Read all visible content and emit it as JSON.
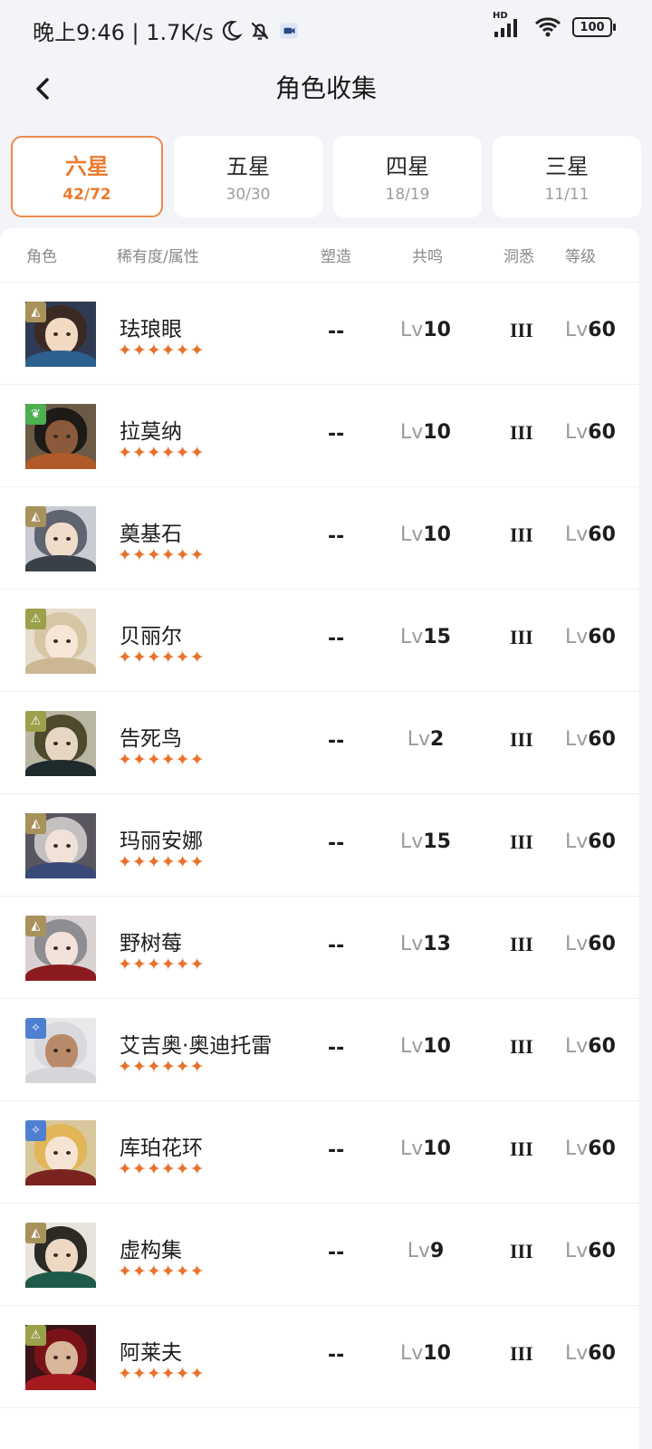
{
  "status_bar": {
    "time": "晚上9:46 | 1.7K/s",
    "network": "HD",
    "battery": "100"
  },
  "header": {
    "title": "角色收集"
  },
  "tabs": [
    {
      "label": "六星",
      "count": "42/72",
      "active": true
    },
    {
      "label": "五星",
      "count": "30/30",
      "active": false
    },
    {
      "label": "四星",
      "count": "18/19",
      "active": false
    },
    {
      "label": "三星",
      "count": "11/11",
      "active": false
    }
  ],
  "columns": {
    "character": "角色",
    "rarity": "稀有度/属性",
    "forge": "塑造",
    "resonance": "共鸣",
    "insight": "洞悉",
    "level": "等级"
  },
  "colors": {
    "accent": "#ec7a2f",
    "star": "#e8722c",
    "attr_beast": "#a8925c",
    "attr_plant": "#4caf50",
    "attr_star": "#4f7fd0",
    "attr_mineral": "#9ba04a"
  },
  "characters": [
    {
      "name": "珐琅眼",
      "stars": "✦✦✦✦✦✦",
      "attr_icon": "beast-icon",
      "attr_color": "#a8925c",
      "forge": "--",
      "reso_lv": "Lv",
      "reso": "10",
      "insight": "III",
      "level_lv": "Lv",
      "level": "60",
      "hair": "#3b2a24",
      "face": "#f1d9c2",
      "bg": "#2f3b52",
      "cloth": "#2d5f8f"
    },
    {
      "name": "拉莫纳",
      "stars": "✦✦✦✦✦✦",
      "attr_icon": "plant-icon",
      "attr_color": "#4caf50",
      "forge": "--",
      "reso_lv": "Lv",
      "reso": "10",
      "insight": "III",
      "level_lv": "Lv",
      "level": "60",
      "hair": "#1e1a17",
      "face": "#8a5a3a",
      "bg": "#6b5a45",
      "cloth": "#b05a2a"
    },
    {
      "name": "奠基石",
      "stars": "✦✦✦✦✦✦",
      "attr_icon": "beast-icon",
      "attr_color": "#a8925c",
      "forge": "--",
      "reso_lv": "Lv",
      "reso": "10",
      "insight": "III",
      "level_lv": "Lv",
      "level": "60",
      "hair": "#5e6470",
      "face": "#efdccb",
      "bg": "#c9ccd2",
      "cloth": "#3a4048"
    },
    {
      "name": "贝丽尔",
      "stars": "✦✦✦✦✦✦",
      "attr_icon": "mineral-icon",
      "attr_color": "#9ba04a",
      "forge": "--",
      "reso_lv": "Lv",
      "reso": "15",
      "insight": "III",
      "level_lv": "Lv",
      "level": "60",
      "hair": "#d7c6a4",
      "face": "#f6e6d6",
      "bg": "#e6ddcc",
      "cloth": "#cbb892"
    },
    {
      "name": "告死鸟",
      "stars": "✦✦✦✦✦✦",
      "attr_icon": "mineral-icon",
      "attr_color": "#9ba04a",
      "forge": "--",
      "reso_lv": "Lv",
      "reso": "2",
      "insight": "III",
      "level_lv": "Lv",
      "level": "60",
      "hair": "#4d4a2e",
      "face": "#e8d6c4",
      "bg": "#b9b6a3",
      "cloth": "#1f2a2c"
    },
    {
      "name": "玛丽安娜",
      "stars": "✦✦✦✦✦✦",
      "attr_icon": "beast-icon",
      "attr_color": "#a8925c",
      "forge": "--",
      "reso_lv": "Lv",
      "reso": "15",
      "insight": "III",
      "level_lv": "Lv",
      "level": "60",
      "hair": "#c4c0c2",
      "face": "#f0e2d8",
      "bg": "#5a5660",
      "cloth": "#3a4a78"
    },
    {
      "name": "野树莓",
      "stars": "✦✦✦✦✦✦",
      "attr_icon": "beast-icon",
      "attr_color": "#a8925c",
      "forge": "--",
      "reso_lv": "Lv",
      "reso": "13",
      "insight": "III",
      "level_lv": "Lv",
      "level": "60",
      "hair": "#8d8d92",
      "face": "#f3e2dc",
      "bg": "#d8d2d2",
      "cloth": "#8c1b1f"
    },
    {
      "name": "艾吉奥·奥迪托雷",
      "stars": "✦✦✦✦✦✦",
      "attr_icon": "star-icon",
      "attr_color": "#4f7fd0",
      "forge": "--",
      "reso_lv": "Lv",
      "reso": "10",
      "insight": "III",
      "level_lv": "Lv",
      "level": "60",
      "hair": "#d9d9dd",
      "face": "#b98a6a",
      "bg": "#e9e9ec",
      "cloth": "#d5d5da"
    },
    {
      "name": "库珀花环",
      "stars": "✦✦✦✦✦✦",
      "attr_icon": "star-icon",
      "attr_color": "#4f7fd0",
      "forge": "--",
      "reso_lv": "Lv",
      "reso": "10",
      "insight": "III",
      "level_lv": "Lv",
      "level": "60",
      "hair": "#e2b658",
      "face": "#f6e4d2",
      "bg": "#d9c79c",
      "cloth": "#7b2320"
    },
    {
      "name": "虚构集",
      "stars": "✦✦✦✦✦✦",
      "attr_icon": "beast-icon",
      "attr_color": "#a8925c",
      "forge": "--",
      "reso_lv": "Lv",
      "reso": "9",
      "insight": "III",
      "level_lv": "Lv",
      "level": "60",
      "hair": "#2b2a24",
      "face": "#eed8c4",
      "bg": "#e8e4dc",
      "cloth": "#1d5a4a"
    },
    {
      "name": "阿莱夫",
      "stars": "✦✦✦✦✦✦",
      "attr_icon": "mineral-icon",
      "attr_color": "#9ba04a",
      "forge": "--",
      "reso_lv": "Lv",
      "reso": "10",
      "insight": "III",
      "level_lv": "Lv",
      "level": "60",
      "hair": "#7a1318",
      "face": "#d9b59a",
      "bg": "#3a1416",
      "cloth": "#a61a1f"
    }
  ]
}
